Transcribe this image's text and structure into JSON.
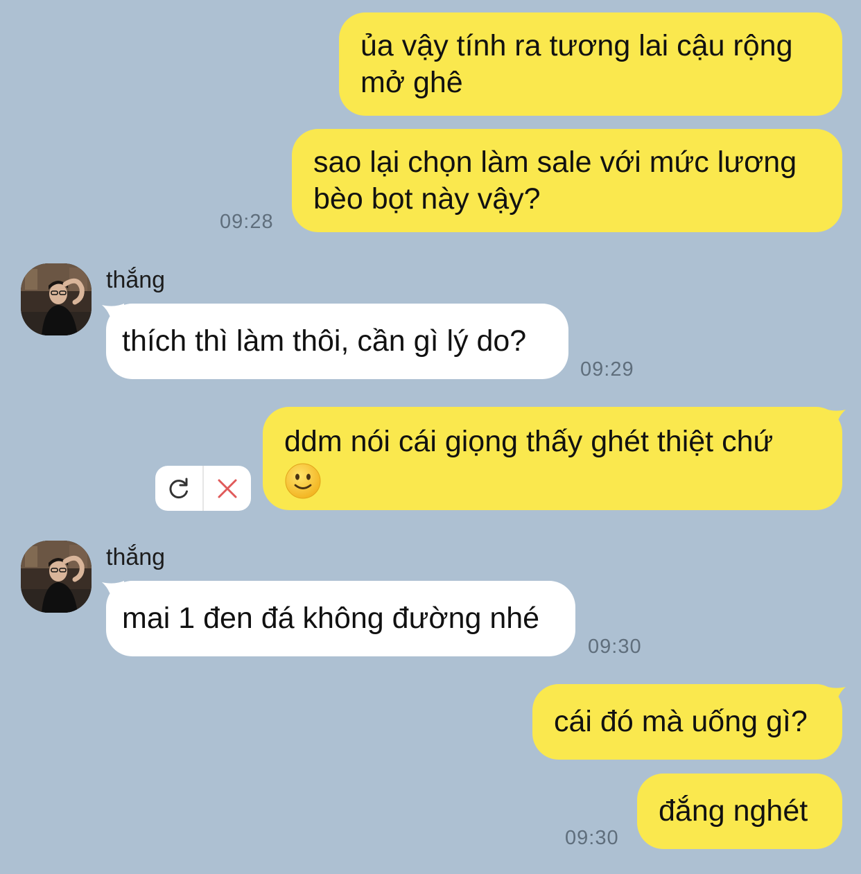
{
  "contact": {
    "name": "thắng"
  },
  "messages": [
    {
      "id": "m1",
      "from": "me",
      "lines": [
        "ủa vậy tính ra tương lai cậu rộng",
        "mở ghê"
      ]
    },
    {
      "id": "m2",
      "from": "me",
      "lines": [
        "sao lại chọn làm sale với mức lương",
        "bèo bọt này vậy?"
      ],
      "time": "09:28"
    },
    {
      "id": "m3",
      "from": "them",
      "sender": "thắng",
      "lines": [
        "thích thì làm thôi, cần gì lý do?"
      ],
      "time": "09:29"
    },
    {
      "id": "m4",
      "from": "me",
      "lines": [
        "ddm nói cái giọng thấy ghét thiệt chứ"
      ],
      "emoji": "slightly-smiling-face",
      "status": "failed"
    },
    {
      "id": "m5",
      "from": "them",
      "sender": "thắng",
      "lines": [
        "mai 1 đen đá không đường nhé"
      ],
      "time": "09:30"
    },
    {
      "id": "m6",
      "from": "me",
      "lines": [
        "cái đó mà uống gì?"
      ]
    },
    {
      "id": "m7",
      "from": "me",
      "lines": [
        "đắng nghét"
      ],
      "time": "09:30"
    }
  ],
  "failed_actions": {
    "retry_icon": "retry-icon",
    "delete_icon": "close-icon"
  },
  "colors": {
    "background": "#adc0d2",
    "my_bubble": "#fae84e",
    "their_bubble": "#ffffff",
    "timestamp": "#5f6e7c",
    "delete": "#e05a5a"
  }
}
